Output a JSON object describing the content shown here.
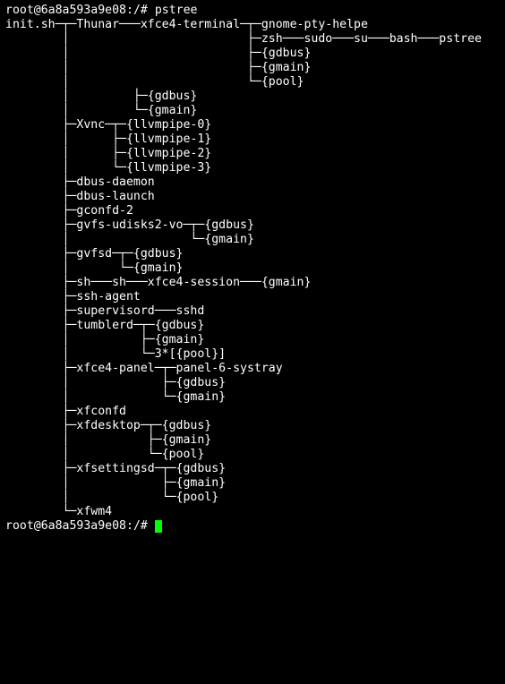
{
  "prompt": {
    "user": "root",
    "host": "6a8a593a9e08",
    "cwd": "/",
    "sep": "#"
  },
  "command": "pstree",
  "lines": [
    "init.sh─┬─Thunar───xfce4-terminal─┬─gnome-pty-helpe",
    "        │                         ├─zsh───sudo───su───bash───pstree",
    "        │                         ├─{gdbus}",
    "        │                         ├─{gmain}",
    "        │                         └─{pool}",
    "        │         ├─{gdbus}",
    "        │         └─{gmain}",
    "        ├─Xvnc─┬─{llvmpipe-0}",
    "        │      ├─{llvmpipe-1}",
    "        │      ├─{llvmpipe-2}",
    "        │      └─{llvmpipe-3}",
    "        ├─dbus-daemon",
    "        ├─dbus-launch",
    "        ├─gconfd-2",
    "        ├─gvfs-udisks2-vo─┬─{gdbus}",
    "        │                 └─{gmain}",
    "        ├─gvfsd─┬─{gdbus}",
    "        │       └─{gmain}",
    "        ├─sh───sh───xfce4-session───{gmain}",
    "        ├─ssh-agent",
    "        ├─supervisord───sshd",
    "        ├─tumblerd─┬─{gdbus}",
    "        │          ├─{gmain}",
    "        │          └─3*[{pool}]",
    "        ├─xfce4-panel─┬─panel-6-systray",
    "        │             ├─{gdbus}",
    "        │             └─{gmain}",
    "        ├─xfconfd",
    "        ├─xfdesktop─┬─{gdbus}",
    "        │           ├─{gmain}",
    "        │           └─{pool}",
    "        ├─xfsettingsd─┬─{gdbus}",
    "        │             ├─{gmain}",
    "        │             └─{pool}",
    "        └─xfwm4"
  ]
}
